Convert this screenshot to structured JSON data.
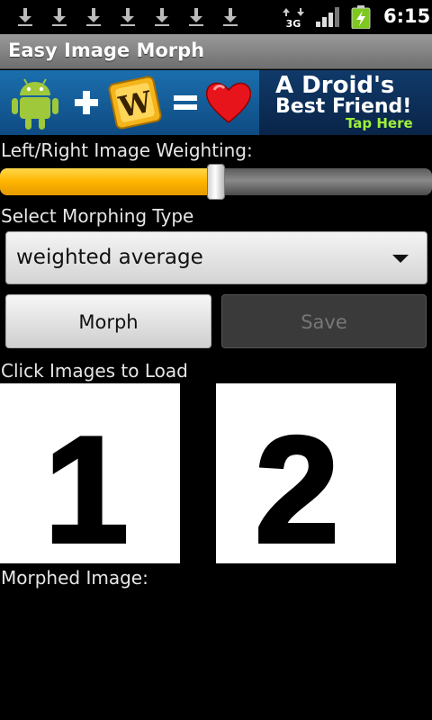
{
  "status_bar": {
    "time": "6:15",
    "network": "3G",
    "notification_icons": [
      "download-icon",
      "download-icon",
      "download-icon",
      "download-icon",
      "download-icon",
      "download-icon",
      "download-icon"
    ]
  },
  "app": {
    "title": "Easy Image Morph"
  },
  "ad_banner": {
    "line1": "A Droid's",
    "line2": "Best Friend!",
    "cta": "Tap Here",
    "tile_letter": "W"
  },
  "weighting": {
    "label": "Left/Right Image Weighting:",
    "value_fraction": 0.5
  },
  "morph_type": {
    "label": "Select Morphing Type",
    "selected": "weighted average"
  },
  "buttons": {
    "morph": "Morph",
    "save": "Save"
  },
  "images": {
    "prompt": "Click Images to Load",
    "left_digit": "1",
    "right_digit": "2"
  },
  "result": {
    "label": "Morphed Image:"
  },
  "colors": {
    "accent": "#ffb400",
    "title_bar": "#7a7a7a",
    "ad_cta": "#9ff03a"
  }
}
